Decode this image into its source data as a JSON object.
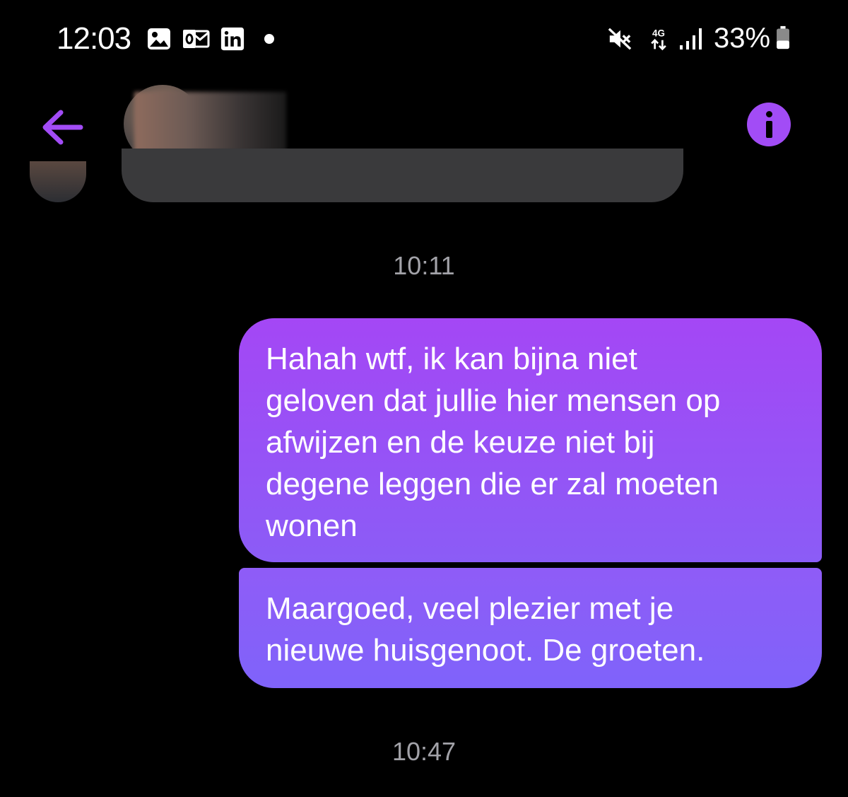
{
  "status_bar": {
    "time": "12:03",
    "icons": [
      "gallery-icon",
      "outlook-icon",
      "linkedin-icon",
      "notification-dot",
      "mute-icon",
      "4g-icon",
      "signal-icon",
      "battery-icon"
    ],
    "network": "4G",
    "battery": "33%"
  },
  "header": {
    "back_icon": "arrow-left-icon",
    "contact_name": "",
    "info_icon": "info-icon"
  },
  "accent_color": "#a24cf6",
  "messages": [
    {
      "type": "timestamp",
      "text": "10:11"
    },
    {
      "type": "sent",
      "text": "Hahah wtf, ik kan bijna niet\ngeloven dat jullie hier mensen op\nafwijzen en de keuze niet bij\ndegene leggen die er zal moeten\nwonen"
    },
    {
      "type": "sent",
      "text": "Maargoed, veel plezier met je\nnieuwe huisgenoot. De groeten."
    },
    {
      "type": "timestamp",
      "text": "10:47"
    }
  ]
}
